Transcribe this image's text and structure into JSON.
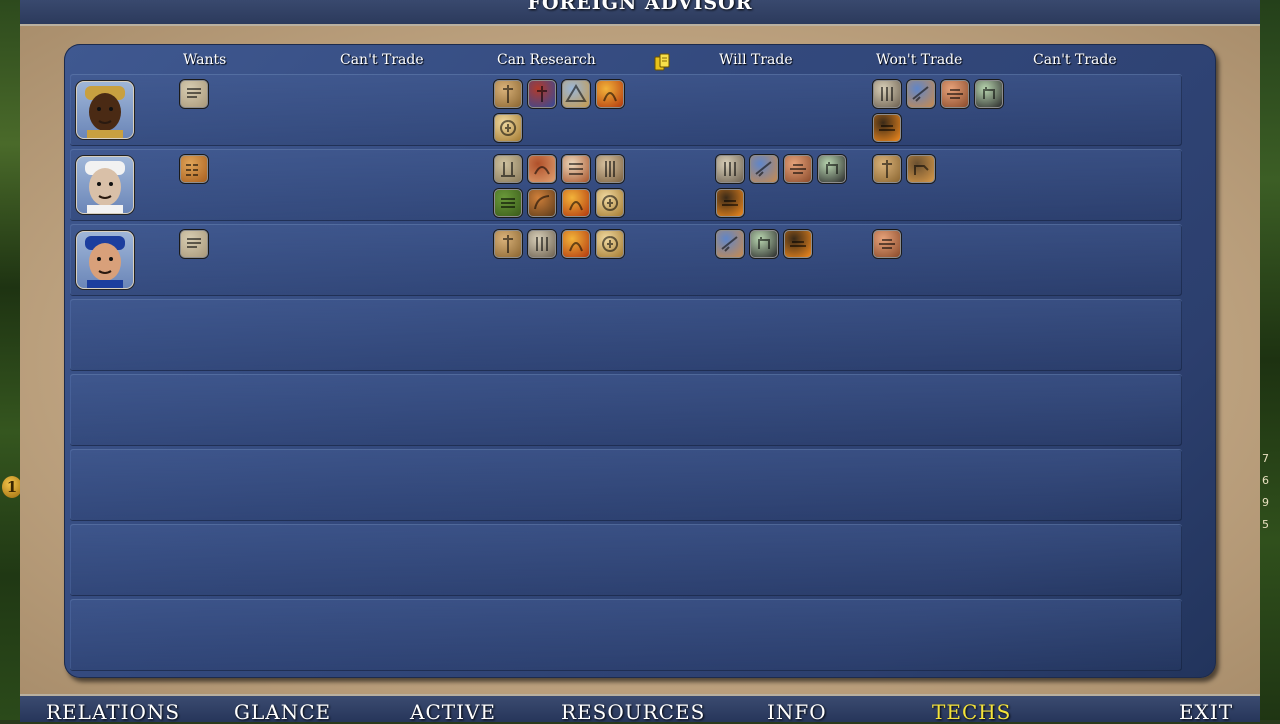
{
  "screen": {
    "title": "FOREIGN ADVISOR"
  },
  "map": {
    "right_numbers": [
      "7",
      "6",
      "9",
      "5"
    ],
    "left_badge": "1"
  },
  "headers": {
    "wants": "Wants",
    "cant_trade_1": "Can't Trade",
    "can_research": "Can Research",
    "gold_icon": "gold-coins-icon",
    "will_trade": "Will Trade",
    "wont_trade": "Won't Trade",
    "cant_trade_2": "Can't Trade"
  },
  "leaders": [
    {
      "portrait": "leader-shaka-icon",
      "wants": [
        "writing-tech-icon"
      ],
      "cant_trade_1": [],
      "can_research": [
        "priesthood-tech-icon",
        "monotheism-tech-icon",
        "masonry-tech-icon",
        "bronze-working-tech-icon",
        "currency-tech-icon"
      ],
      "will_trade": [],
      "wont_trade": [
        "mysticism-tech-icon",
        "fishing-tech-icon",
        "the-wheel-tech-icon",
        "animal-husbandry-tech-icon",
        "iron-working-tech-icon"
      ],
      "cant_trade_2": []
    },
    {
      "portrait": "leader-gandhi-icon",
      "wants": [
        "alphabet-tech-icon"
      ],
      "cant_trade_1": [],
      "can_research": [
        "polytheism-tech-icon",
        "hunting-tech-icon",
        "mathematics-tech-icon",
        "meditation-tech-icon",
        "agriculture-tech-icon",
        "archery-tech-icon",
        "bronze-working-tech-icon",
        "currency-tech-icon"
      ],
      "will_trade": [
        "mysticism-tech-icon",
        "fishing-tech-icon",
        "the-wheel-tech-icon",
        "animal-husbandry-tech-icon",
        "iron-working-tech-icon"
      ],
      "wont_trade": [
        "priesthood-tech-icon",
        "horseback-riding-tech-icon"
      ],
      "cant_trade_2": []
    },
    {
      "portrait": "leader-genghis-khan-icon",
      "wants": [
        "writing-tech-icon"
      ],
      "cant_trade_1": [],
      "can_research": [
        "priesthood-tech-icon",
        "mysticism-tech-icon",
        "bronze-working-tech-icon",
        "currency-tech-icon"
      ],
      "will_trade": [
        "fishing-tech-icon",
        "animal-husbandry-tech-icon",
        "iron-working-tech-icon"
      ],
      "wont_trade": [
        "the-wheel-tech-icon"
      ],
      "cant_trade_2": []
    }
  ],
  "empty_rows": 5,
  "bottom_nav": [
    {
      "label": "RELATIONS",
      "active": false
    },
    {
      "label": "GLANCE",
      "active": false
    },
    {
      "label": "ACTIVE",
      "active": false
    },
    {
      "label": "RESOURCES",
      "active": false
    },
    {
      "label": "INFO",
      "active": false
    },
    {
      "label": "TECHS",
      "active": true
    },
    {
      "label": "EXIT",
      "active": false
    }
  ],
  "colors": {
    "panel": "#33497d",
    "active_tab": "#f4e33a",
    "parchment": "#c2a784"
  }
}
